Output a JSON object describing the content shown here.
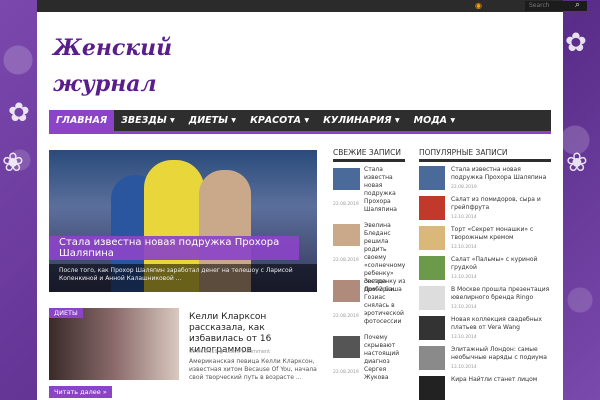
{
  "topbar": {
    "search_placeholder": "Search",
    "rss_icon": "rss-icon",
    "search_icon": "search-icon"
  },
  "site": {
    "logo": "Женский журнал"
  },
  "nav": {
    "items": [
      "ГЛАВНАЯ",
      "ЗВЕЗДЫ ▾",
      "ДИЕТЫ ▾",
      "КРАСОТА ▾",
      "КУЛИНАРИЯ ▾",
      "МОДА ▾"
    ]
  },
  "hero": {
    "title": "Стала известна новая подружка Прохора Шаляпина",
    "excerpt": "После того, как Прохор Шаляпин заработал денег на телешоу с Ларисой Копенкиной и Анной Калашниковой ..."
  },
  "post2": {
    "tag": "ДИЕТЫ",
    "title": "Келли Кларксон рассказала, как избавилась от 16 килограммов",
    "meta": "09.06.2019   ◉ Leave a comment",
    "excerpt": "Американская певица Келли Кларксон, известная хитом Because Of You, начала свой творческий путь в возрасте ...",
    "read_more": "Читать далее »"
  },
  "recent": {
    "heading": "СВЕЖИЕ ЗАПИСИ",
    "items": [
      {
        "title": "Стала известна новая подружка Прохора Шаляпина",
        "date": "22.08.2019"
      },
      {
        "title": "Эвелина Бледанс решила родить своему «солнечному ребенку» сестренку из пробирки",
        "date": "22.08.2019"
      },
      {
        "title": "Звезда Дом-2 Саша Гозиас снялась в эротической фотосессии",
        "date": "22.08.2019"
      },
      {
        "title": "Почему скрывают настоящий диагноз Сергея Жукова",
        "date": "22.08.2019"
      }
    ]
  },
  "popular": {
    "heading": "ПОПУЛЯРНЫЕ ЗАПИСИ",
    "items": [
      {
        "title": "Стала известна новая подружка Прохора Шаляпина",
        "date": "22.08.2019"
      },
      {
        "title": "Салат из помидоров, сыра и грейпфрута",
        "date": "13.10.2014"
      },
      {
        "title": "Торт «Секрет монашки» с творожным кремом",
        "date": "13.10.2014"
      },
      {
        "title": "Салат «Пальмы» с куриной грудкой",
        "date": "13.10.2014"
      },
      {
        "title": "В Москве прошла презентация ювелирного бренда Ringo",
        "date": "13.10.2014"
      },
      {
        "title": "Новая коллекция свадебных платьев от Vera Wang",
        "date": "13.10.2014"
      },
      {
        "title": "Элитажный Лондон: самые необычные наряды с подиума",
        "date": "13.10.2014"
      },
      {
        "title": "Кира Найтли станет лицом",
        "date": ""
      }
    ]
  }
}
